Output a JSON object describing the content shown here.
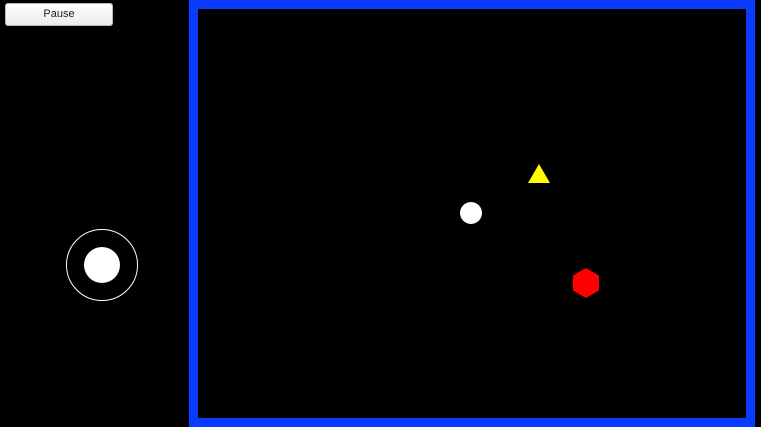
{
  "controls": {
    "pause_label": "Pause"
  },
  "joystick": {
    "knob_offset": [
      0,
      0
    ]
  },
  "arena": {
    "border_color": "#0a3cff",
    "background_color": "#000000"
  },
  "entities": [
    {
      "kind": "player",
      "shape": "circle",
      "color": "#ffffff"
    },
    {
      "kind": "enemy",
      "shape": "triangle",
      "color": "#ffff00"
    },
    {
      "kind": "enemy",
      "shape": "hexagon",
      "color": "#ff0000"
    }
  ]
}
